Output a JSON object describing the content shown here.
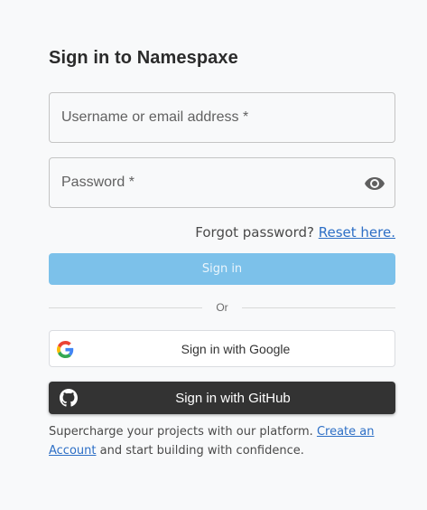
{
  "page": {
    "title": "Sign in to Namespaxe"
  },
  "form": {
    "username_label": "Username or email address *",
    "password_label": "Password *",
    "forgot_text": "Forgot password?",
    "reset_link": "Reset here.",
    "signin_label": "Sign in",
    "divider_text": "Or"
  },
  "social": {
    "google_label": "Sign in with Google",
    "github_label": "Sign in with GitHub"
  },
  "footer": {
    "text_before": "Supercharge your projects with our platform. ",
    "create_link": "Create an Account",
    "text_after": " and start building with confidence."
  },
  "colors": {
    "background": "#f8f9fa",
    "signin_button": "#7cc1ea",
    "github_button": "#333333",
    "link": "#2d6fc6"
  },
  "icons": {
    "password_toggle": "eye-icon",
    "google": "google-logo-icon",
    "github": "github-logo-icon"
  }
}
